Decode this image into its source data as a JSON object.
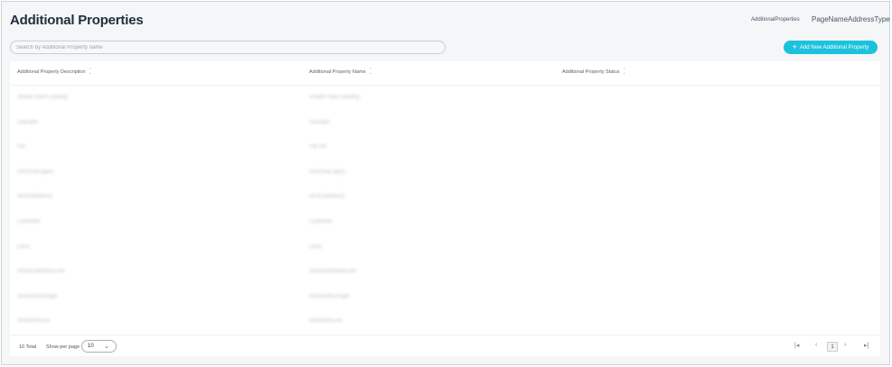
{
  "page": {
    "title": "Additional Properties"
  },
  "breadcrumb": {
    "item1": "AdditionalProperties",
    "item2": "PageNameAddressType"
  },
  "search": {
    "placeholder": "Search by Additional Property name"
  },
  "toolbar": {
    "add_label": "Add New Additional Property",
    "add_icon": "plus-icon"
  },
  "table": {
    "columns": [
      "Additional Property Description",
      "Additional Property Name",
      "Additional Property Status"
    ],
    "rows": [
      {
        "description": "Shade Paint Leading",
        "name": "Shade Paint Leading",
        "status": ""
      },
      {
        "description": "Dwindell",
        "name": "Dwindell",
        "status": ""
      },
      {
        "description": "Pal",
        "name": "Pal Pkt",
        "status": ""
      },
      {
        "description": "RiP(OneLayer)",
        "name": "RiP(OneLayer)",
        "status": ""
      },
      {
        "description": "RiP(OneMess)",
        "name": "RiP(OneMess)",
        "status": ""
      },
      {
        "description": "LastRefer",
        "name": "LastRefer",
        "status": ""
      },
      {
        "description": "LenD",
        "name": "LenD",
        "status": ""
      },
      {
        "description": "ShoreDeliNewsLink",
        "name": "ShoreDeliNewsLink",
        "status": ""
      },
      {
        "description": "ShoreDelsSingle",
        "name": "ShoreDelsSingle",
        "status": ""
      },
      {
        "description": "ShoreRefLink",
        "name": "ShoreRefLink",
        "status": ""
      }
    ]
  },
  "footer": {
    "total": "10 Total",
    "show_per_page": "Show per page",
    "per_page_value": "10",
    "current_page": "1"
  },
  "colors": {
    "accent": "#1bc2dd",
    "title": "#1f2d3d",
    "background": "#f4f6f8"
  }
}
